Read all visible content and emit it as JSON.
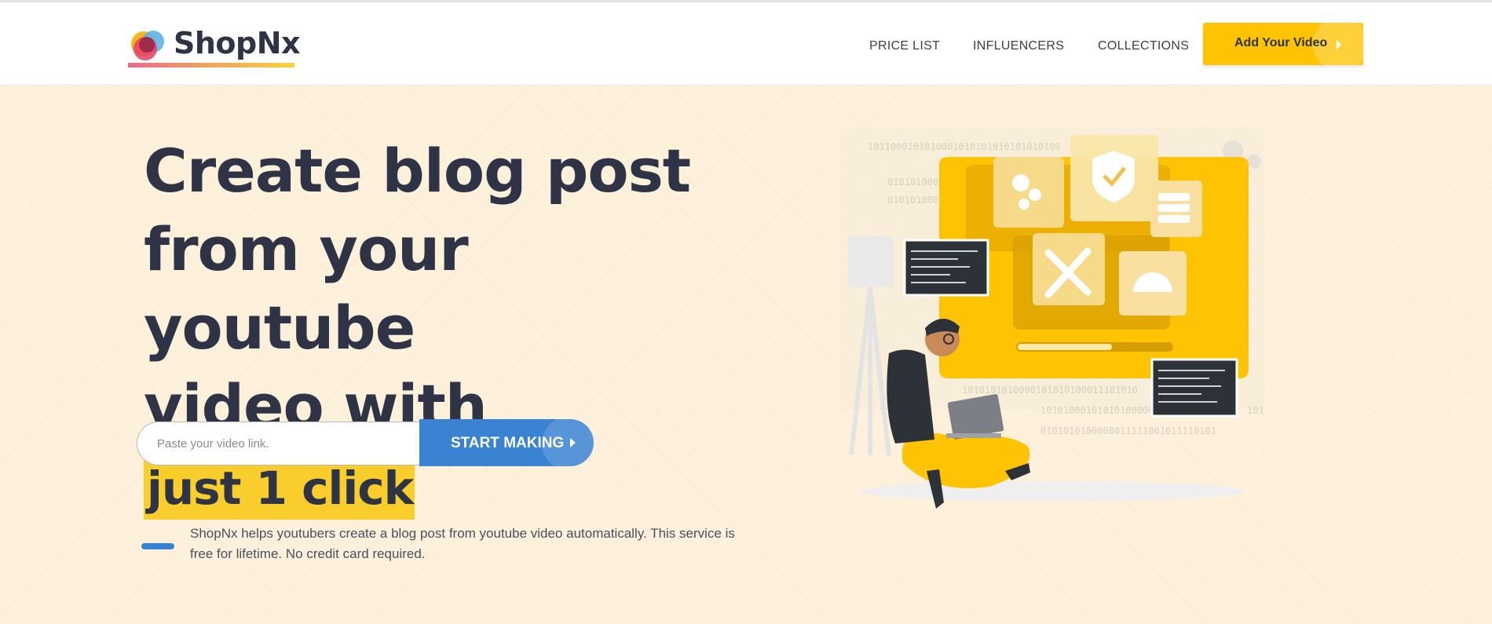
{
  "brand": {
    "name": "ShopNx",
    "colors": {
      "accent_yellow": "#fec403",
      "accent_blue": "#3a82d2",
      "text_dark": "#2e3445",
      "hero_bg": "#fdf1dc"
    }
  },
  "nav": {
    "items": [
      {
        "label": "PRICE LIST"
      },
      {
        "label": "INFLUENCERS"
      },
      {
        "label": "COLLECTIONS"
      }
    ],
    "cta_label": "Add Your Video",
    "cta_icon": "caret-right-icon"
  },
  "hero": {
    "title_line1": "Create blog post",
    "title_line2": "from your youtube",
    "title_line3_prefix": "video with",
    "title_highlight": "just 1 click",
    "input_placeholder": "Paste your video link.",
    "input_value": "",
    "start_label": "START MAKING",
    "start_icon": "caret-right-icon",
    "description": "ShopNx helps youtubers create a blog post from youtube video automatically. This service is free for lifetime. No credit card required."
  },
  "illustration": {
    "binary_rows": [
      "1011000101010001010101010101010100",
      "010101000",
      "010101000",
      "1010101010000101010100011101010",
      "101010001010101000000",
      "0101010100000011111001011110101",
      "00101",
      "101"
    ]
  }
}
